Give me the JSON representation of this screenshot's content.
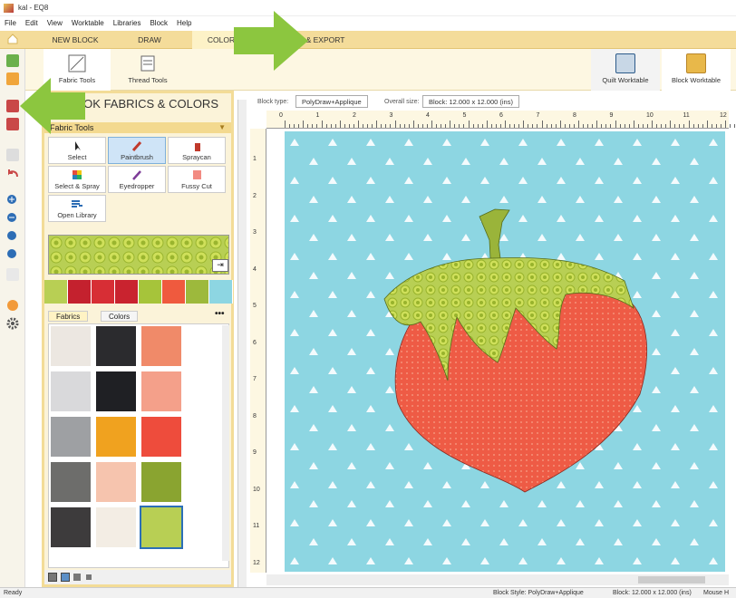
{
  "window": {
    "title": "kal - EQ8"
  },
  "menu": [
    "File",
    "Edit",
    "View",
    "Worktable",
    "Libraries",
    "Block",
    "Help"
  ],
  "tabs": {
    "new_block": "NEW BLOCK",
    "draw": "DRAW",
    "color": "COLOR",
    "export": "& EXPORT"
  },
  "ribbon": {
    "fabric_tools": "Fabric Tools",
    "thread_tools": "Thread Tools",
    "quilt_worktable": "Quilt Worktable",
    "block_worktable": "Block Worktable"
  },
  "panel": {
    "title": "HBOOK FABRICS & COLORS",
    "section": "Fabric Tools",
    "tools": [
      "Select",
      "Paintbrush",
      "Spraycan",
      "Select & Spray",
      "Eyedropper",
      "Fussy Cut",
      "Open Library"
    ],
    "subtabs": {
      "fabrics": "Fabrics",
      "colors": "Colors"
    },
    "more": "•••"
  },
  "infobar": {
    "block_type_label": "Block type:",
    "block_type": "PolyDraw+Applique",
    "overall_label": "Overall size:",
    "overall": "Block: 12.000 x 12.000 (ins)"
  },
  "ruler": {
    "top": [
      "0",
      "1",
      "2",
      "3",
      "4",
      "5",
      "6",
      "7",
      "8",
      "9",
      "10",
      "11",
      "12"
    ],
    "left": [
      "1",
      "2",
      "3",
      "4",
      "5",
      "6",
      "7",
      "8",
      "9",
      "10",
      "11",
      "12"
    ]
  },
  "status": {
    "ready": "Ready",
    "block_style": "Block Style: PolyDraw+Applique",
    "block": "Block: 12.000 x 12.000 (ins)",
    "mouse": "Mouse  H"
  },
  "colors": {
    "accent": "#f4dc9a",
    "sky": "#8dd6e2",
    "berry": "#ee5b45",
    "leaf": "#b8cf54",
    "arrow": "#8cc63f"
  }
}
